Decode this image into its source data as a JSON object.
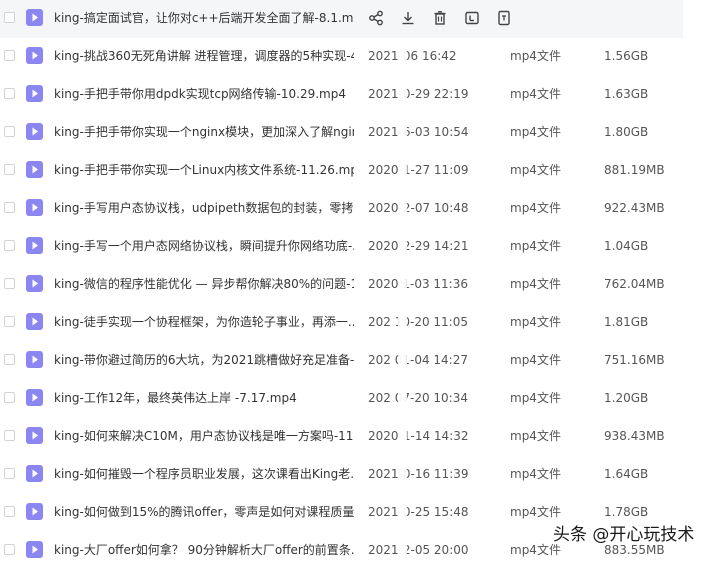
{
  "colors": {
    "file_icon": "#8c86f2",
    "hover_row": "#f5f6f8",
    "action_icon": "#444444"
  },
  "hover_actions": [
    {
      "name": "share-icon"
    },
    {
      "name": "download-icon"
    },
    {
      "name": "delete-icon"
    },
    {
      "name": "rename-icon"
    },
    {
      "name": "more-icon"
    }
  ],
  "files": [
    {
      "name": "king-搞定面试官，让你对c++后端开发全面了解-8.1.mp4",
      "time": "",
      "type": "",
      "size": "",
      "icon": "video-file-icon"
    },
    {
      "name": "king-挑战360无死角讲解 进程管理，调度器的5种实现-4...",
      "time": "2021-06 16:42",
      "type": "mp4文件",
      "size": "1.56GB",
      "icon": "video-file-icon"
    },
    {
      "name": "king-手把手带你用dpdk实现tcp网络传输-10.29.mp4",
      "time": "2021-0-29 22:19",
      "type": "mp4文件",
      "size": "1.63GB",
      "icon": "video-file-icon"
    },
    {
      "name": "king-手把手带你实现一个nginx模块，更加深入了解ngin...",
      "time": "2021-6-03 10:54",
      "type": "mp4文件",
      "size": "1.80GB",
      "icon": "video-file-icon"
    },
    {
      "name": "king-手把手带你实现一个Linux内核文件系统-11.26.mp4",
      "time": "2020-1-27 11:09",
      "type": "mp4文件",
      "size": "881.19MB",
      "icon": "video-file-icon"
    },
    {
      "name": "king-手写用户态协议栈，udpipeth数据包的封装，零拷...",
      "time": "2020-2-07 10:48",
      "type": "mp4文件",
      "size": "922.43MB",
      "icon": "video-file-icon"
    },
    {
      "name": "king-手写一个用户态网络协议栈，瞬间提升你网络功底-...",
      "time": "2020-2-29 14:21",
      "type": "mp4文件",
      "size": "1.04GB",
      "icon": "video-file-icon"
    },
    {
      "name": "king-微信的程序性能优化 — 异步帮你解决80%的问题-1...",
      "time": "2020 1-03 11:36",
      "type": "mp4文件",
      "size": "762.04MB",
      "icon": "video-file-icon"
    },
    {
      "name": "king-徒手实现一个协程框架，为你造轮子事业，再添一...",
      "time": "202 10-20 11:05",
      "type": "mp4文件",
      "size": "1.81GB",
      "icon": "video-file-icon"
    },
    {
      "name": "king-带你避过简历的6大坑，为2021跳槽做好充足准备-...",
      "time": "202 01-04 14:27",
      "type": "mp4文件",
      "size": "751.16MB",
      "icon": "video-file-icon"
    },
    {
      "name": "king-工作12年，最终英伟达上岸 -7.17.mp4",
      "time": "202 07-20 10:34",
      "type": "mp4文件",
      "size": "1.20GB",
      "icon": "video-file-icon"
    },
    {
      "name": "king-如何来解决C10M，用户态协议栈是唯一方案吗-11....",
      "time": "2020-1-14 14:32",
      "type": "mp4文件",
      "size": "938.43MB",
      "icon": "video-file-icon"
    },
    {
      "name": "king-如何摧毁一个程序员职业发展，这次课看出King老...",
      "time": "2021-0-16 11:39",
      "type": "mp4文件",
      "size": "1.64GB",
      "icon": "video-file-icon"
    },
    {
      "name": "king-如何做到15%的腾讯offer，零声是如何对课程质量...",
      "time": "2021-0-25 15:48",
      "type": "mp4文件",
      "size": "1.78GB",
      "icon": "video-file-icon"
    },
    {
      "name": "king-大厂offer如何拿？ 90分钟解析大厂offer的前置条...",
      "time": "2021-2-05 20:00",
      "type": "mp4文件",
      "size": "883.55MB",
      "icon": "video-file-icon"
    }
  ],
  "watermark": "头条 @开心玩技术"
}
